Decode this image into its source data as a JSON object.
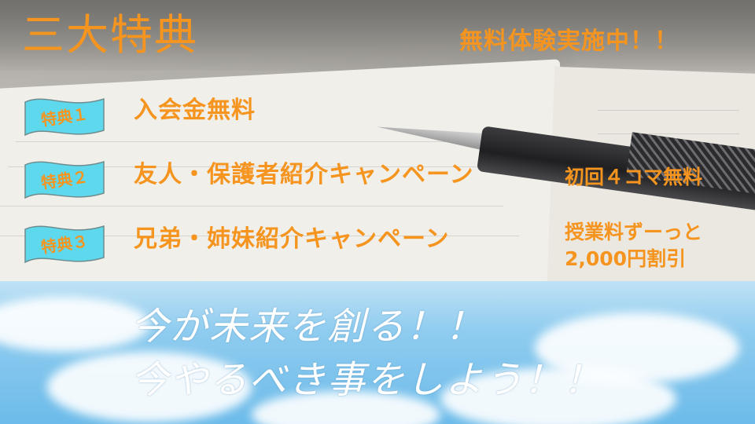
{
  "title": "三大特典",
  "trial_banner": "無料体験実施中！！",
  "benefits": [
    {
      "tag": "特典１",
      "name": "入会金無料",
      "note": ""
    },
    {
      "tag": "特典２",
      "name": "友人・保護者紹介キャンペーン",
      "note": "初回４コマ無料"
    },
    {
      "tag": "特典３",
      "name": "兄弟・姉妹紹介キャンペーン",
      "note_line1": "授業料ずーっと",
      "note_line2": "2,000円割引"
    }
  ],
  "slogan": {
    "line1": "今が未来を創る！！",
    "line2": "今やるべき事をしよう！！"
  },
  "colors": {
    "accent": "#f5951f",
    "flag_fill": "#5ed8ec",
    "flag_stroke": "#6e8c8e",
    "slogan_text": "#ffffff",
    "sky": "#8fccef"
  }
}
